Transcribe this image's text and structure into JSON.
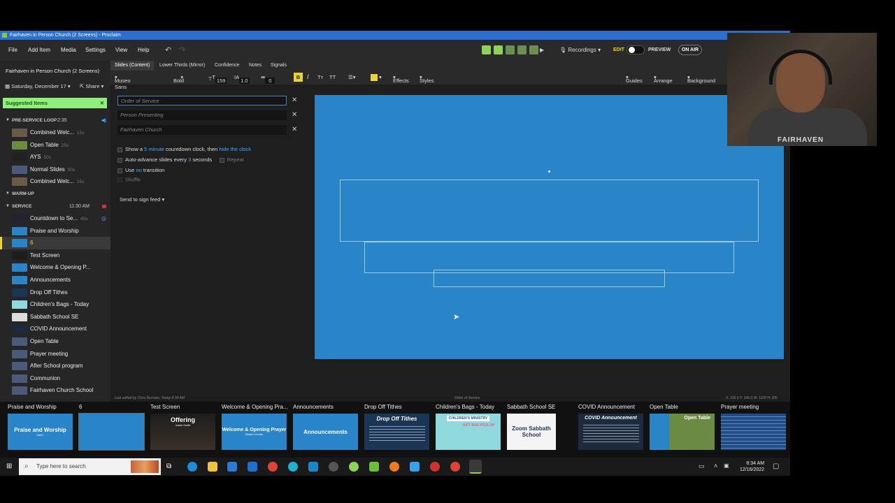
{
  "window": {
    "title": "Fairhaven in Person Church (2 Screens) - Proclaim"
  },
  "menubar": {
    "items": [
      "File",
      "Add Item",
      "Media",
      "Settings",
      "View",
      "Help"
    ],
    "recordings": "Recordings",
    "edit": "EDIT",
    "preview": "PREVIEW",
    "on_air": "ON AIR"
  },
  "left": {
    "service_title": "Fairhaven in Person Church (2 Screens)",
    "date": "Saturday, December 17",
    "share": "Share",
    "suggested": "Suggested Items",
    "sections": [
      {
        "label": "PRE-SERVICE LOOP",
        "time": "2:35"
      },
      {
        "label": "WARM-UP",
        "time": ""
      },
      {
        "label": "SERVICE",
        "time": "11:30 AM"
      }
    ],
    "preservice_items": [
      {
        "label": "Combined Welc...",
        "dur": "15s"
      },
      {
        "label": "Open Table",
        "dur": "25s"
      },
      {
        "label": "AYS",
        "dur": "50s"
      },
      {
        "label": "Normal Slides",
        "dur": "50s"
      },
      {
        "label": "Combined Welc...",
        "dur": "15s"
      }
    ],
    "service_items": [
      {
        "label": "Countdown to Se...",
        "dur": "45s"
      },
      {
        "label": "Praise and Worship",
        "dur": ""
      },
      {
        "label": "6",
        "dur": ""
      },
      {
        "label": "Test Screen",
        "dur": ""
      },
      {
        "label": "Welcome & Opening P...",
        "dur": ""
      },
      {
        "label": "Announcements",
        "dur": ""
      },
      {
        "label": "Drop Off Tithes",
        "dur": ""
      },
      {
        "label": "Children's Bags - Today",
        "dur": ""
      },
      {
        "label": "Sabbath School SE",
        "dur": ""
      },
      {
        "label": "COVID Announcement",
        "dur": ""
      },
      {
        "label": "Open Table",
        "dur": ""
      },
      {
        "label": "Prayer meeting",
        "dur": ""
      },
      {
        "label": "After School program",
        "dur": ""
      },
      {
        "label": "Communion",
        "dur": ""
      },
      {
        "label": "Fairhaven Church School",
        "dur": ""
      }
    ]
  },
  "editor": {
    "tabs": [
      "Slides (Content)",
      "Lower Thirds (Mirror)",
      "Confidence",
      "Notes",
      "Signals"
    ],
    "font": "Museo Sans",
    "weight": "Bold",
    "font_size": "159",
    "line_spacing": "1.0",
    "letter_spacing": "0",
    "effects": "Effects",
    "styles": "Styles",
    "guides": "Guides",
    "arrange": "Arrange",
    "background": "Background",
    "fields": [
      {
        "placeholder": "Order of Service"
      },
      {
        "placeholder": "Person Presenting"
      },
      {
        "placeholder": "Fairhaven Church"
      }
    ],
    "options": {
      "countdown_a": "Show a",
      "countdown_b": "5 minute",
      "countdown_c": "countdown clock, then",
      "countdown_d": "hide the clock",
      "advance_a": "Auto-advance slides every",
      "advance_b": "3",
      "advance_c": "seconds",
      "repeat": "Repeat",
      "transition_a": "Use",
      "transition_b": "no",
      "transition_c": "transition",
      "shuffle": "Shuffle"
    },
    "send_to_sign": "Send to sign feed",
    "last_edited": "Last edited by Chris Burrows, Today 8:34 AM",
    "order_label": "Order of Service",
    "coords": "X: 105.0  Y: 345.0  W: 1100  H: 205"
  },
  "strip": [
    {
      "label": "Praise and Worship",
      "title": "Praise and Worship",
      "sub": "Visit 1",
      "bg": "#2a85c8"
    },
    {
      "label": "6",
      "title": "",
      "sub": "",
      "bg": "#2a85c8"
    },
    {
      "label": "Test Screen",
      "title": "Offering",
      "sub": "Justin Smith",
      "bg": "#1d1d1d"
    },
    {
      "label": "Welcome & Opening Pra...",
      "title": "Welcome & Opening Prayer",
      "sub": "Elders Combs",
      "bg": "#2a85c8"
    },
    {
      "label": "Announcements",
      "title": "Announcements",
      "sub": "",
      "bg": "#2a85c8"
    },
    {
      "label": "Drop Off Tithes",
      "title": "Drop Off Tithes",
      "sub": "",
      "bg": "#1b3554"
    },
    {
      "label": "Children's Bags - Today",
      "title": "CHILDREN'S MINISTRY",
      "sub": "GIFT BAG PICK-UP",
      "bg": "#8fd9dc"
    },
    {
      "label": "Sabbath School SE",
      "title": "Zoom Sabbath School",
      "sub": "",
      "bg": "#f4f4f4"
    },
    {
      "label": "COVID Announcement",
      "title": "COVID Announcement",
      "sub": "",
      "bg": "#1c2a3d"
    },
    {
      "label": "Open Table",
      "title": "Open Table",
      "sub": "",
      "bg": "#6b8a43"
    },
    {
      "label": "Prayer meeting",
      "title": "",
      "sub": "",
      "bg": "#1f4d8a"
    }
  ],
  "taskbar": {
    "search_placeholder": "Type here to search",
    "time": "8:34 AM",
    "date": "12/16/2022"
  },
  "webcam": {
    "shirt_text": "FAIRHAVEN"
  }
}
